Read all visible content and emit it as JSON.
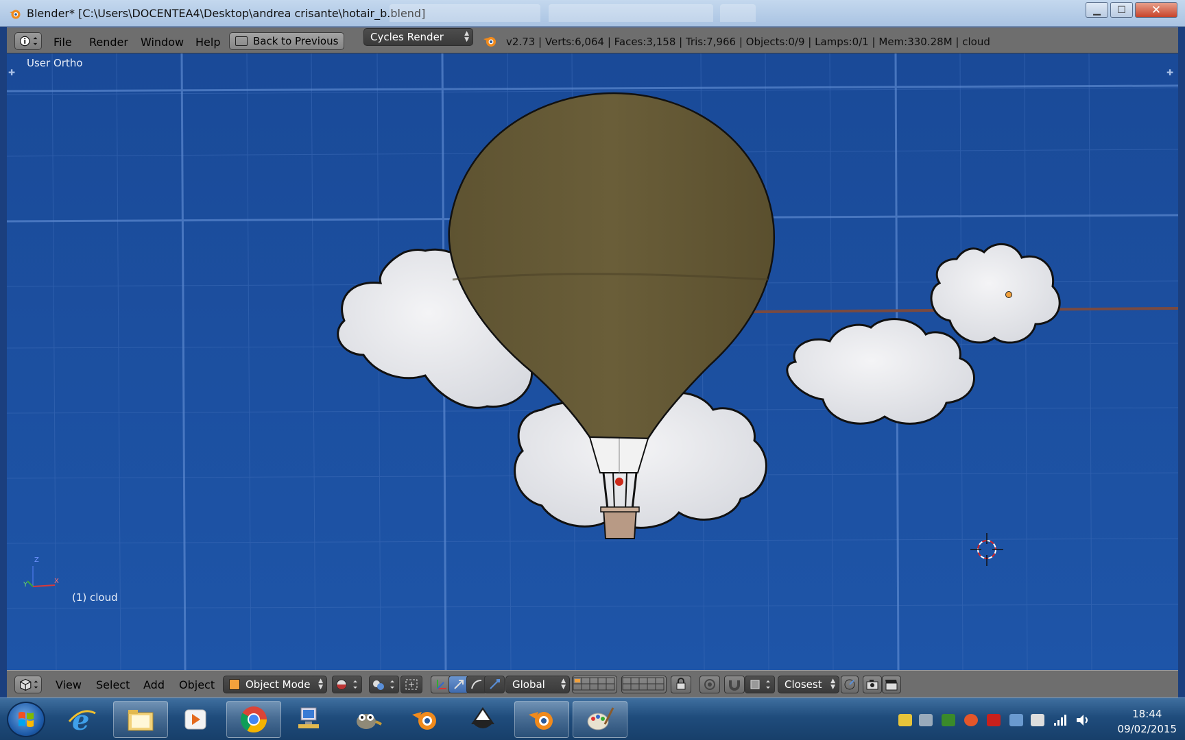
{
  "window": {
    "title": "Blender* [C:\\Users\\DOCENTEA4\\Desktop\\andrea crisante\\hotair_b.blend]",
    "minimize_label": "▁",
    "maximize_label": "☐",
    "close_label": "✕"
  },
  "info_header": {
    "menus": [
      "File",
      "Render",
      "Window",
      "Help"
    ],
    "back_button": "Back to Previous",
    "render_engine": "Cycles Render",
    "stats": "v2.73 | Verts:6,064 | Faces:3,158 | Tris:7,966 | Objects:0/9 | Lamps:0/1 | Mem:330.28M | cloud"
  },
  "viewport": {
    "view_name": "User Ortho",
    "active_object_label": "(1) cloud",
    "axis_labels": {
      "z": "Z",
      "y": "Y",
      "x": "X"
    },
    "background_color": "#1d4f9f"
  },
  "view3d_header": {
    "menus": [
      "View",
      "Select",
      "Add",
      "Object"
    ],
    "mode": "Object Mode",
    "orientation": "Global",
    "snap_target": "Closest"
  },
  "taskbar": {
    "apps": [
      "internet-explorer",
      "file-explorer",
      "media-player",
      "chrome",
      "network-folder",
      "gimp",
      "blender",
      "inkscape",
      "blender",
      "paint"
    ],
    "clock_time": "18:44",
    "clock_date": "09/02/2015"
  }
}
